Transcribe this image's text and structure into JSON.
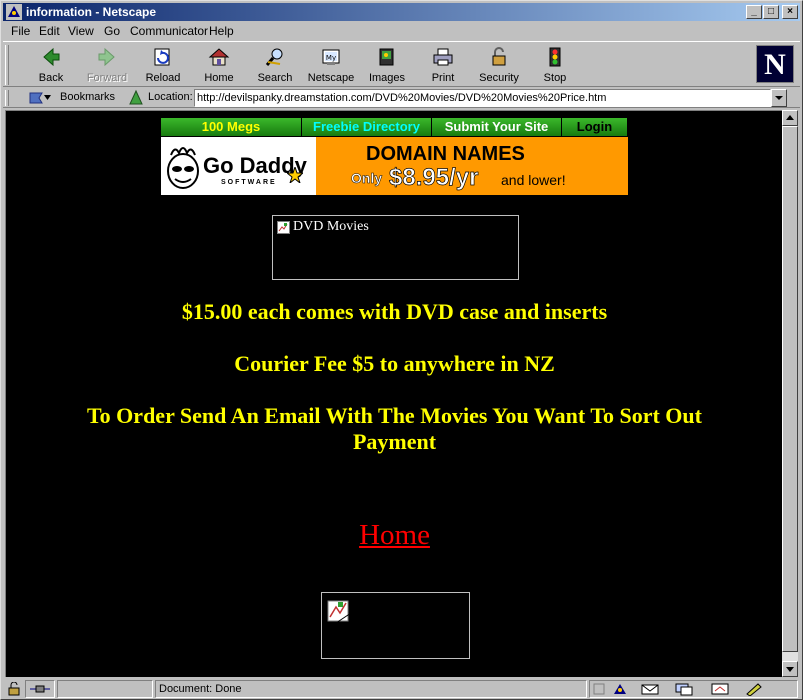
{
  "window": {
    "title": "information - Netscape"
  },
  "menu": {
    "items": [
      {
        "label": "File"
      },
      {
        "label": "Edit"
      },
      {
        "label": "View"
      },
      {
        "label": "Go"
      },
      {
        "label": "Communicator"
      },
      {
        "label": "Help"
      }
    ]
  },
  "toolbar": {
    "buttons": [
      {
        "label": "Back",
        "icon": "back-arrow-icon"
      },
      {
        "label": "Forward",
        "icon": "forward-arrow-icon",
        "disabled": true
      },
      {
        "label": "Reload",
        "icon": "reload-icon"
      },
      {
        "label": "Home",
        "icon": "home-icon"
      },
      {
        "label": "Search",
        "icon": "search-icon"
      },
      {
        "label": "Netscape",
        "icon": "netscape-my-icon"
      },
      {
        "label": "Images",
        "icon": "images-icon"
      },
      {
        "label": "Print",
        "icon": "print-icon"
      },
      {
        "label": "Security",
        "icon": "lock-icon"
      },
      {
        "label": "Stop",
        "icon": "stop-icon"
      }
    ],
    "logo": "N"
  },
  "location": {
    "bookmarks_label": "Bookmarks",
    "location_label": "Location:",
    "url": "http://devilspanky.dreamstation.com/DVD%20Movies/DVD%20Movies%20Price.htm"
  },
  "page": {
    "banner_nav": [
      {
        "label": "100 Megs",
        "color": "#ffff00"
      },
      {
        "label": "Freebie Directory",
        "color": "#00ffff"
      },
      {
        "label": "Submit Your Site",
        "color": "#ffffff"
      },
      {
        "label": "Login",
        "color": "#000000"
      }
    ],
    "ad": {
      "logo_text": "Go Daddy",
      "logo_sub": "SOFTWARE",
      "headline": "DOMAIN NAMES",
      "only": "Only",
      "price": "$8.95/yr",
      "tail": "and lower!"
    },
    "image_alt": "DVD Movies",
    "line1": "$15.00 each comes with DVD case and inserts",
    "line2": "Courier Fee $5 to anywhere in NZ",
    "line3": "To Order Send An Email With The Movies You Want To Sort Out Payment",
    "home_link": "Home"
  },
  "status": {
    "text": "Document: Done"
  },
  "colors": {
    "page_background": "#000000",
    "text_yellow": "#ffff00",
    "link_red": "#ff0000",
    "ad_orange": "#ff9900"
  }
}
